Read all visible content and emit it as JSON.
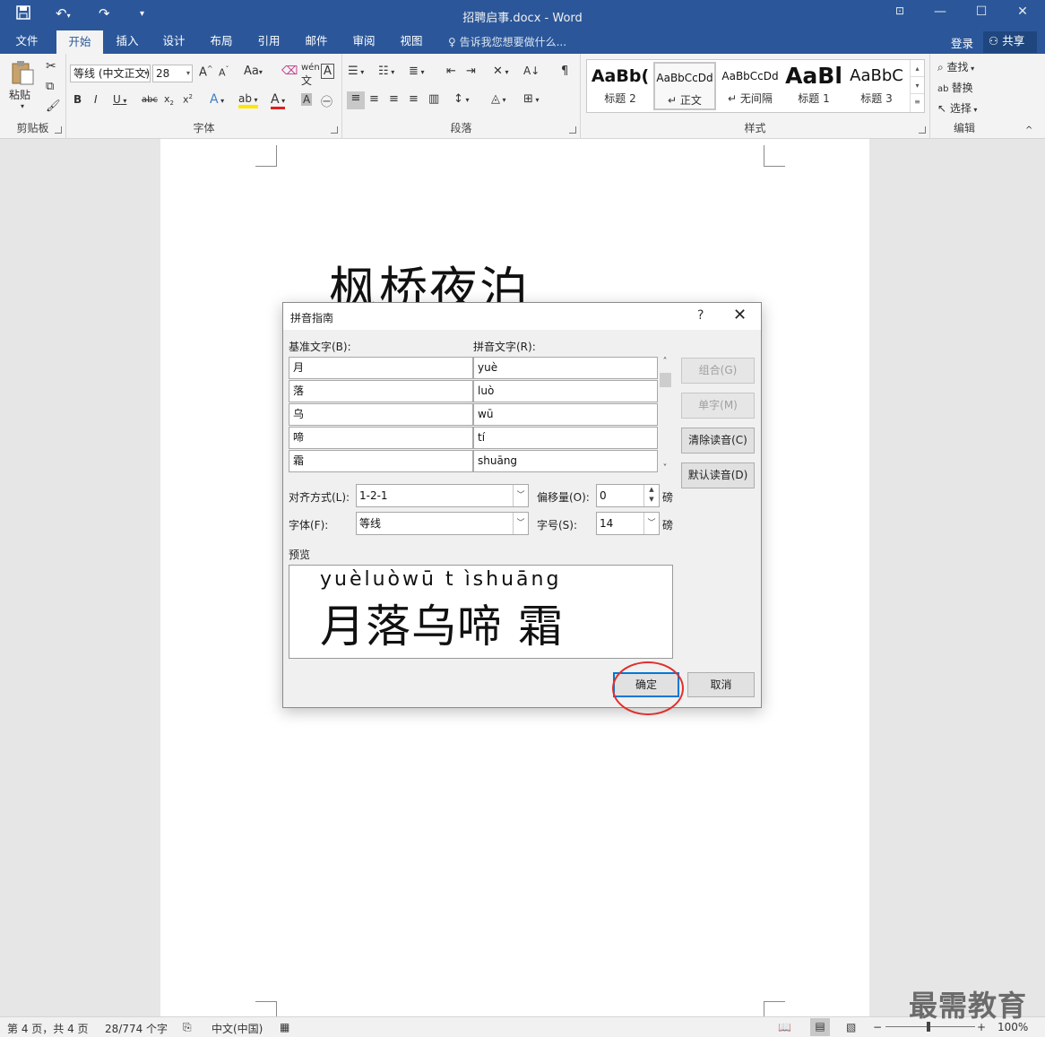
{
  "window": {
    "title": "招聘启事.docx - Word",
    "min_icon": "minimize-icon",
    "restore_icon": "restore-icon",
    "close_icon": "close-icon"
  },
  "quick_access": {
    "undo_icon": "undo-icon",
    "redo_icon": "redo-icon",
    "save_icon": "save-icon"
  },
  "tabs": [
    "文件",
    "开始",
    "插入",
    "设计",
    "布局",
    "引用",
    "邮件",
    "审阅",
    "视图"
  ],
  "active_tab": "开始",
  "tell_me": "告诉我您想要做什么...",
  "login": "登录",
  "share": "共享",
  "ribbon": {
    "clipboard": {
      "paste": "粘贴",
      "label": "剪贴板"
    },
    "font": {
      "name": "等线 (中文正文)",
      "size": "28",
      "label": "字体"
    },
    "paragraph": {
      "label": "段落"
    },
    "styles": {
      "label": "样式",
      "items": [
        {
          "sample": "AaBb(",
          "name": "标题 2"
        },
        {
          "sample": "AaBbCcDd",
          "name": "正文"
        },
        {
          "sample": "AaBbCcDd",
          "name": "无间隔"
        },
        {
          "sample": "AaBl",
          "name": "标题 1"
        },
        {
          "sample": "AaBbC",
          "name": "标题 3"
        }
      ]
    },
    "editing": {
      "find": "查找",
      "replace": "替换",
      "select": "选择",
      "label": "编辑"
    }
  },
  "document": {
    "title_text": "枫桥夜泊"
  },
  "dialog": {
    "title": "拼音指南",
    "help": "?",
    "close": "✕",
    "base_text_label": "基准文字(B):",
    "ruby_text_label": "拼音文字(R):",
    "rows": [
      {
        "base": "月",
        "ruby": "yuè"
      },
      {
        "base": "落",
        "ruby": "luò"
      },
      {
        "base": "乌",
        "ruby": "wū"
      },
      {
        "base": "啼",
        "ruby": "tí"
      },
      {
        "base": "霜",
        "ruby": "shuāng"
      }
    ],
    "buttons": {
      "group": "组合(G)",
      "mono": "单字(M)",
      "clear": "清除读音(C)",
      "default": "默认读音(D)",
      "ok": "确定",
      "cancel": "取消"
    },
    "alignment_label": "对齐方式(L):",
    "alignment_value": "1-2-1",
    "offset_label": "偏移量(O):",
    "offset_value": "0",
    "offset_unit": "磅",
    "font_label": "字体(F):",
    "font_value": "等线",
    "size_label": "字号(S):",
    "size_value": "14",
    "size_unit": "磅",
    "preview_label": "预览",
    "preview_ruby": "yuèluòwū t ìshuāng",
    "preview_base": "月落乌啼 霜"
  },
  "status": {
    "page": "第 4 页，共 4 页",
    "words": "28/774 个字",
    "language": "中文(中国)",
    "zoom": "100%"
  },
  "watermark": "最需教育",
  "colors": {
    "accent": "#2b579a",
    "annotation": "#e0302e"
  }
}
